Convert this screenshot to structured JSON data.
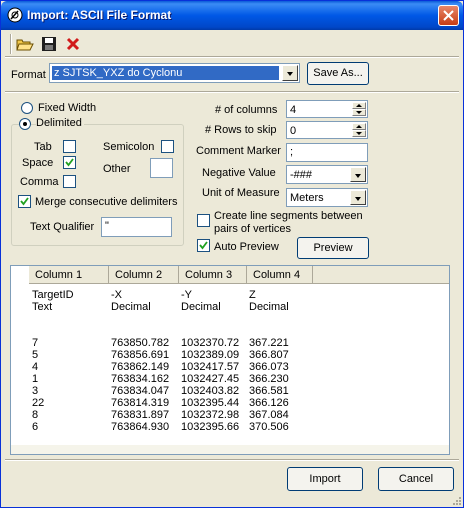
{
  "window": {
    "title": "Import: ASCII File Format"
  },
  "toolbar": {
    "open": "open-folder-icon",
    "save": "save-disk-icon",
    "delete": "delete-x-icon"
  },
  "format": {
    "label": "Format",
    "value": "z SJTSK_YXZ do Cyclonu",
    "save_as": "Save As..."
  },
  "delimiter": {
    "fixed_width": "Fixed Width",
    "delimited": "Delimited",
    "tab": "Tab",
    "semicolon": "Semicolon",
    "space": "Space",
    "other": "Other",
    "comma": "Comma",
    "merge": "Merge consecutive delimiters",
    "text_qualifier_label": "Text Qualifier",
    "text_qualifier_value": "\"",
    "checked": {
      "tab": false,
      "semicolon": false,
      "space": true,
      "comma": false,
      "merge": true
    },
    "selected_mode": "Delimited"
  },
  "options": {
    "columns_label": "# of columns",
    "columns_value": "4",
    "rows_skip_label": "# Rows to skip",
    "rows_skip_value": "0",
    "comment_label": "Comment Marker",
    "comment_value": ";",
    "negative_label": "Negative Value",
    "negative_value": "-###",
    "unit_label": "Unit of Measure",
    "unit_value": "Meters",
    "segments_label_1": "Create line segments between",
    "segments_label_2": "pairs of vertices",
    "auto_preview_label": "Auto Preview",
    "preview_button": "Preview",
    "segments_checked": false,
    "auto_preview_checked": true
  },
  "preview": {
    "headers": [
      "Column 1",
      "Column 2",
      "Column 3",
      "Column 4"
    ],
    "rows": [
      [
        "TargetID",
        "-X",
        "-Y",
        "Z"
      ],
      [
        "Text",
        "Decimal",
        "Decimal",
        "Decimal"
      ],
      [
        "",
        "",
        "",
        ""
      ],
      [
        "",
        "",
        "",
        ""
      ],
      [
        "7",
        "763850.782",
        "1032370.72",
        "367.221"
      ],
      [
        "5",
        "763856.691",
        "1032389.09",
        "366.807"
      ],
      [
        "4",
        "763862.149",
        "1032417.57",
        "366.073"
      ],
      [
        "1",
        "763834.162",
        "1032427.45",
        "366.230"
      ],
      [
        "3",
        "763834.047",
        "1032403.82",
        "366.581"
      ],
      [
        "22",
        "763814.319",
        "1032395.44",
        "366.126"
      ],
      [
        "8",
        "763831.897",
        "1032372.98",
        "367.084"
      ],
      [
        "6",
        "763864.930",
        "1032395.66",
        "370.506"
      ]
    ]
  },
  "buttons": {
    "import": "Import",
    "cancel": "Cancel"
  }
}
